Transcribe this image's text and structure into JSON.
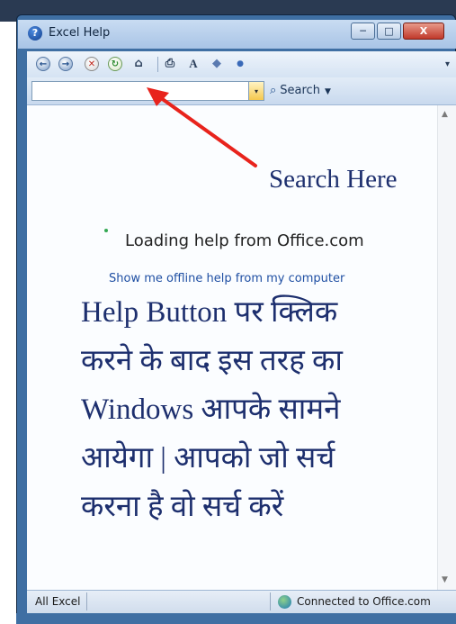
{
  "window": {
    "title": "Excel Help",
    "controls": {
      "minimize": "─",
      "maximize": "□",
      "close": "X"
    }
  },
  "toolbar": {
    "icons": [
      "back-icon",
      "forward-icon",
      "stop-icon",
      "refresh-icon",
      "home-icon",
      "print-icon",
      "font-size-icon",
      "book-icon",
      "pin-icon"
    ],
    "glyphs": {
      "back": "←",
      "forward": "→",
      "stop": "✕",
      "refresh": "↻",
      "home": "⌂",
      "print": "⎙",
      "font": "A",
      "book": "◆",
      "pin": "●",
      "chevron": "▾"
    }
  },
  "search": {
    "value": "",
    "button_label": "Search",
    "dropdown_glyph": "▾"
  },
  "content": {
    "loading_text": "Loading help from Office.com",
    "offline_link": "Show me offline help from my computer"
  },
  "annotation": {
    "search_callout": "Search Here",
    "lines": [
      "Help Button पर क्लिक",
      "करने के बाद इस तरह का",
      "Windows आपके सामने",
      "आयेगा | आपको जो सर्च",
      "करना है वो सर्च करें"
    ],
    "arrow_color": "#e8231c",
    "text_color": "#1d2f6e"
  },
  "statusbar": {
    "left": "All Excel",
    "right": "Connected to Office.com"
  }
}
